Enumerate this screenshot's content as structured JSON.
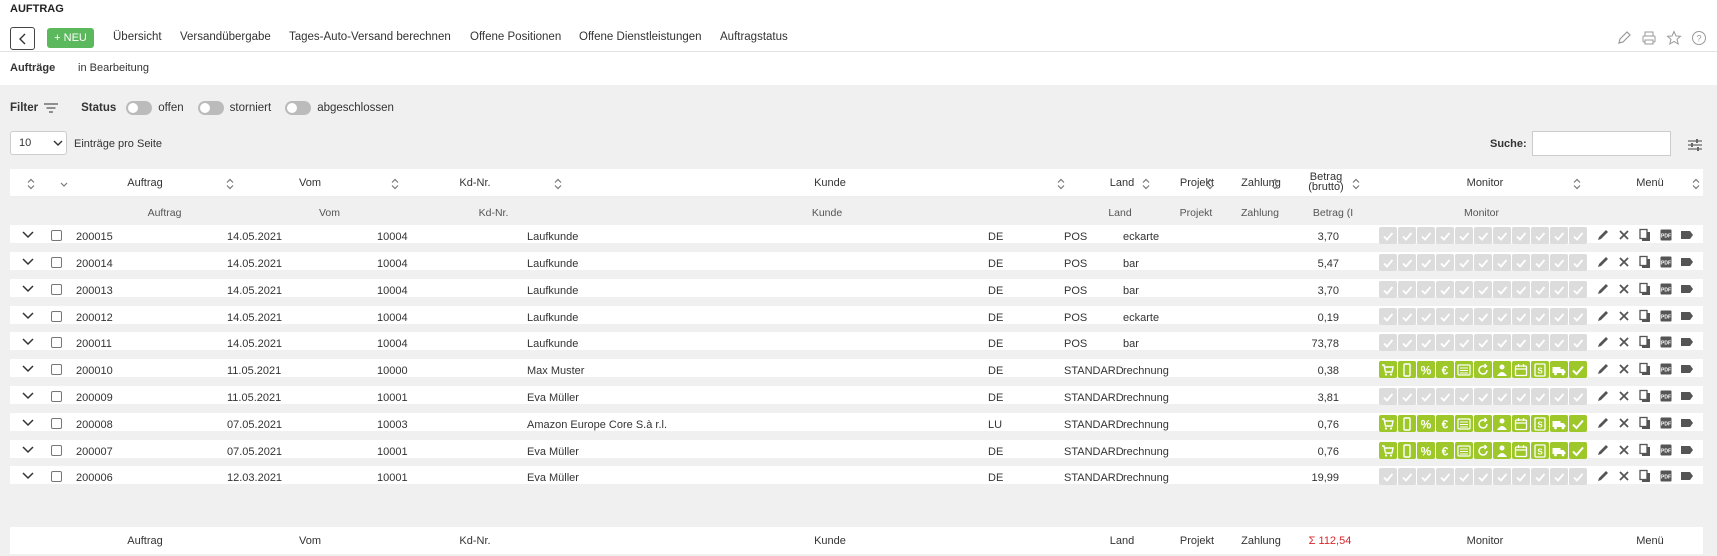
{
  "app": {
    "title": "AUFTRAG"
  },
  "toolbar": {
    "new_label": "+ NEU"
  },
  "tabs": [
    "Übersicht",
    "Versandübergabe",
    "Tages-Auto-Versand berechnen",
    "Offene Positionen",
    "Offene Dienstleistungen",
    "Auftragstatus"
  ],
  "subnav": [
    "Aufträge",
    "in Bearbeitung"
  ],
  "filter": {
    "label": "Filter",
    "status_label": "Status",
    "options": [
      "offen",
      "storniert",
      "abgeschlossen"
    ]
  },
  "pagination": {
    "page_size": "10",
    "per_page_label": "Einträge pro Seite"
  },
  "search": {
    "label": "Suche:",
    "value": ""
  },
  "table": {
    "headers": {
      "auftrag": "Auftrag",
      "vom": "Vom",
      "kdnr": "Kd-Nr.",
      "kunde": "Kunde",
      "land": "Land",
      "projekt": "Projekt",
      "zahlung": "Zahlung",
      "betrag": "Betrag (brutto)",
      "monitor": "Monitor",
      "menu": "Menü"
    },
    "filter_placeholders": {
      "auftrag": "Auftrag",
      "vom": "Vom",
      "kdnr": "Kd-Nr.",
      "kunde": "Kunde",
      "land": "Land",
      "projekt": "Projekt",
      "zahlung": "Zahlung",
      "betrag": "Betrag (I",
      "monitor": "Monitor"
    },
    "rows": [
      {
        "auftrag": "200015",
        "vom": "14.05.2021",
        "kdnr": "10004",
        "kunde": "Laufkunde",
        "land": "DE",
        "projekt": "POS",
        "zahlung": "eckarte",
        "betrag": "3,70",
        "monitor": "grey"
      },
      {
        "auftrag": "200014",
        "vom": "14.05.2021",
        "kdnr": "10004",
        "kunde": "Laufkunde",
        "land": "DE",
        "projekt": "POS",
        "zahlung": "bar",
        "betrag": "5,47",
        "monitor": "grey"
      },
      {
        "auftrag": "200013",
        "vom": "14.05.2021",
        "kdnr": "10004",
        "kunde": "Laufkunde",
        "land": "DE",
        "projekt": "POS",
        "zahlung": "bar",
        "betrag": "3,70",
        "monitor": "grey"
      },
      {
        "auftrag": "200012",
        "vom": "14.05.2021",
        "kdnr": "10004",
        "kunde": "Laufkunde",
        "land": "DE",
        "projekt": "POS",
        "zahlung": "eckarte",
        "betrag": "0,19",
        "monitor": "grey"
      },
      {
        "auftrag": "200011",
        "vom": "14.05.2021",
        "kdnr": "10004",
        "kunde": "Laufkunde",
        "land": "DE",
        "projekt": "POS",
        "zahlung": "bar",
        "betrag": "73,78",
        "monitor": "grey"
      },
      {
        "auftrag": "200010",
        "vom": "11.05.2021",
        "kdnr": "10000",
        "kunde": "Max Muster",
        "land": "DE",
        "projekt": "STANDARD",
        "zahlung": "rechnung",
        "betrag": "0,38",
        "monitor": "green"
      },
      {
        "auftrag": "200009",
        "vom": "11.05.2021",
        "kdnr": "10001",
        "kunde": "Eva Müller",
        "land": "DE",
        "projekt": "STANDARD",
        "zahlung": "rechnung",
        "betrag": "3,81",
        "monitor": "grey"
      },
      {
        "auftrag": "200008",
        "vom": "07.05.2021",
        "kdnr": "10003",
        "kunde": "Amazon Europe Core S.à r.l.",
        "land": "LU",
        "projekt": "STANDARD",
        "zahlung": "rechnung",
        "betrag": "0,76",
        "monitor": "green"
      },
      {
        "auftrag": "200007",
        "vom": "07.05.2021",
        "kdnr": "10001",
        "kunde": "Eva Müller",
        "land": "DE",
        "projekt": "STANDARD",
        "zahlung": "rechnung",
        "betrag": "0,76",
        "monitor": "green"
      },
      {
        "auftrag": "200006",
        "vom": "12.03.2021",
        "kdnr": "10001",
        "kunde": "Eva Müller",
        "land": "DE",
        "projekt": "STANDARD",
        "zahlung": "rechnung",
        "betrag": "19,99",
        "monitor": "grey"
      }
    ],
    "footer": {
      "auftrag": "Auftrag",
      "vom": "Vom",
      "kdnr": "Kd-Nr.",
      "kunde": "Kunde",
      "land": "Land",
      "projekt": "Projekt",
      "zahlung": "Zahlung",
      "sum": "Σ 112,54",
      "monitor": "Monitor",
      "menu": "Menü"
    }
  },
  "colors": {
    "green": "#5cb85c",
    "monitor_green": "#9ec72a",
    "monitor_grey": "#dcdcdc",
    "sum_red": "#d9262a"
  },
  "monitor_icons": [
    "cart-icon",
    "phone-icon",
    "percent-icon",
    "euro-icon",
    "lines-icon",
    "refresh-icon",
    "person-icon",
    "calendar-icon",
    "document-icon",
    "truck-icon",
    "check-icon"
  ],
  "menu_icons": [
    "edit-icon",
    "delete-icon",
    "copy-icon",
    "pdf-icon",
    "tag-icon"
  ]
}
